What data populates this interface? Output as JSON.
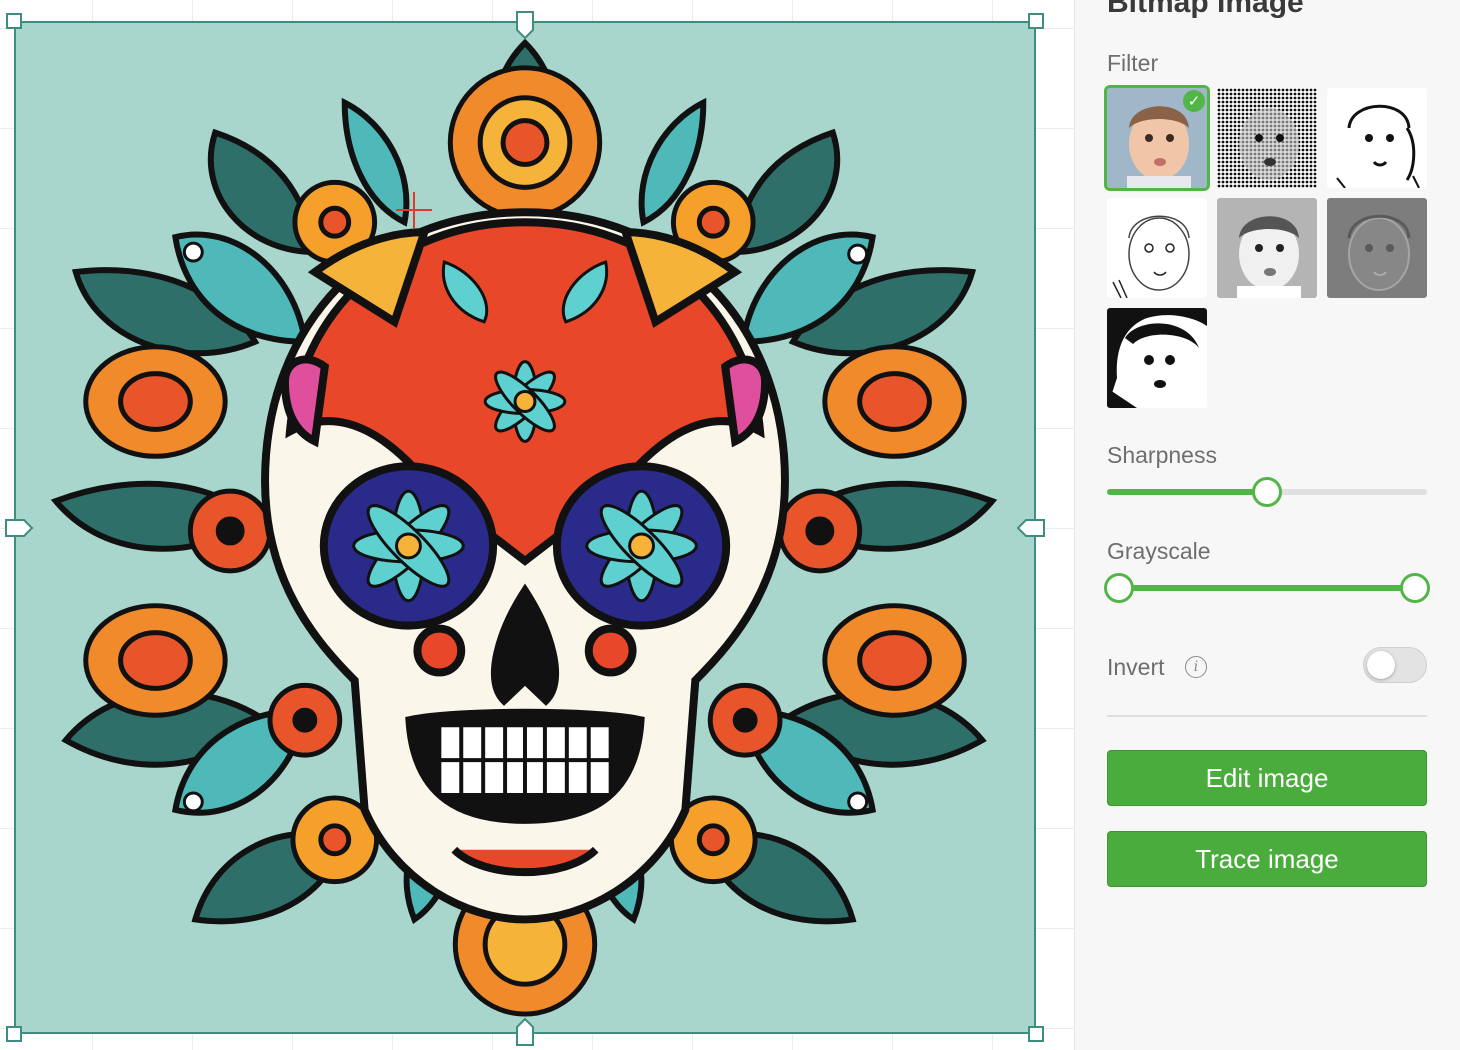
{
  "panel": {
    "title": "Bitmap Image",
    "filter_label": "Filter",
    "filters": [
      {
        "name": "original",
        "selected": true
      },
      {
        "name": "halftone",
        "selected": false
      },
      {
        "name": "high-contrast",
        "selected": false
      },
      {
        "name": "sketch",
        "selected": false
      },
      {
        "name": "grayscale-light",
        "selected": false
      },
      {
        "name": "emboss",
        "selected": false
      },
      {
        "name": "threshold",
        "selected": false
      }
    ],
    "sharpness_label": "Sharpness",
    "sharpness_value": 0.5,
    "grayscale_label": "Grayscale",
    "grayscale_range": [
      0,
      1
    ],
    "invert_label": "Invert",
    "invert_on": false,
    "info_glyph": "i",
    "check_glyph": "✓",
    "edit_button": "Edit image",
    "trace_button": "Trace image"
  },
  "colors": {
    "accent": "#52b548",
    "button": "#4aac3c",
    "image_background": "#a8d6cc",
    "frame": "#3f8c80"
  },
  "icons": {
    "selected_check": "check-icon",
    "info": "info-icon"
  }
}
